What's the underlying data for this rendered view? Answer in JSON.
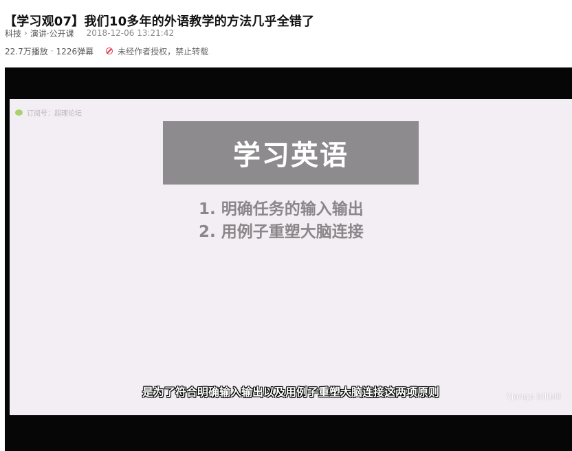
{
  "page": {
    "title": "【学习观07】我们10多年的外语教学的方法几乎全错了"
  },
  "meta": {
    "category": "科技",
    "subcategory": "演讲·公开课",
    "date": "2018-12-06 13:21:42"
  },
  "stats": {
    "plays": "22.7万播放",
    "separator": "·",
    "danmaku": "1226弹幕",
    "notice": "未经作者授权，禁止转载"
  },
  "video": {
    "watermark_tl": "订阅号：超理论坛",
    "slide_title": "学习英语",
    "slide_points": [
      "1. 明确任务的输入输出",
      "2. 用例子重塑大脑连接"
    ],
    "subtitle": "是为了符合明确输入输出以及用例子重塑大脑连接这两项原则",
    "watermark_br": "Yjango bilibili"
  },
  "icons": {
    "notice_icon": "ban-icon",
    "watermark_icon": "wechat-icon",
    "breadcrumb_separator": "chevron-right-icon"
  },
  "colors": {
    "warning": "#e0324b",
    "slide_box": "#8e8b8e",
    "slide_background": "#f3eef3"
  }
}
